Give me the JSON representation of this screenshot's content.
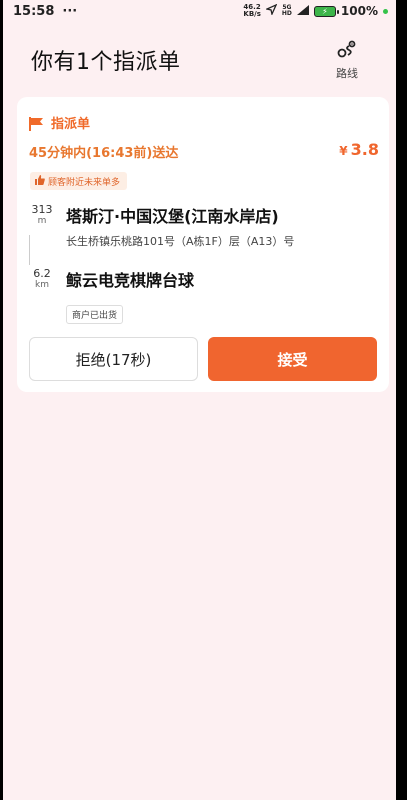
{
  "status_bar": {
    "time": "15:58",
    "more": "···",
    "net_speed_value": "46.2",
    "net_speed_unit": "KB/s",
    "signal": "5G",
    "signal_sub": "HD",
    "battery_label": "100%"
  },
  "header": {
    "title": "你有1个指派单",
    "route_label": "路线"
  },
  "order": {
    "type_label": "指派单",
    "deadline": "45分钟内(16:43前)送达",
    "currency": "¥",
    "price": "3.8",
    "tag": "顾客附近未来单多",
    "pickup": {
      "distance": "313",
      "unit": "m",
      "name": "塔斯汀·中国汉堡(江南水岸店)",
      "address": "长生桥镇乐桃路101号（A栋1F）层（A13）号"
    },
    "dropoff": {
      "distance": "6.2",
      "unit": "km",
      "name": "鲸云电竞棋牌台球"
    },
    "status": "商户已出货",
    "reject_label": "拒绝(17秒)",
    "accept_label": "接受"
  },
  "colors": {
    "accent": "#f0652f",
    "page_bg": "#fdf0f2",
    "tag_bg": "#fdeee4"
  }
}
